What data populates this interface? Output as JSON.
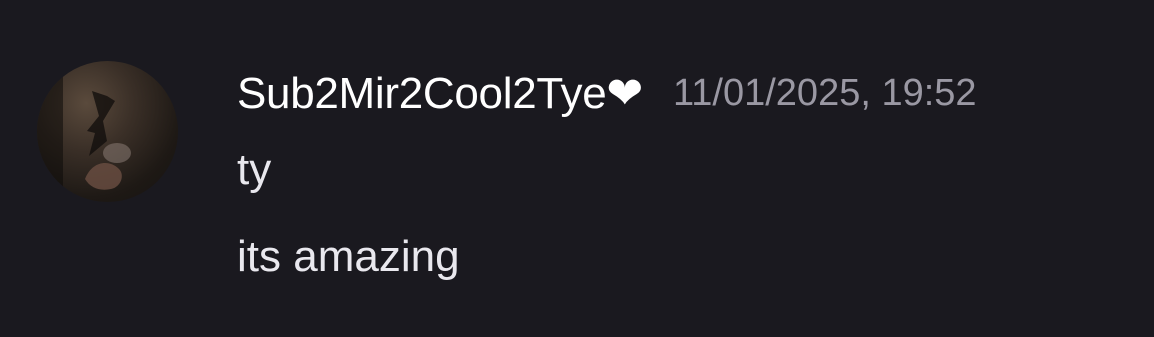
{
  "message": {
    "author": {
      "display_name": "Sub2Mir2Cool2Tye❤︎",
      "avatar_icon": "user-avatar-photo"
    },
    "timestamp": "11/01/2025, 19:52",
    "lines": [
      "ty",
      "its amazing"
    ]
  },
  "colors": {
    "background": "#1a191f",
    "username": "#ffffff",
    "timestamp": "#9a98a3",
    "text": "#e9e8ee"
  }
}
